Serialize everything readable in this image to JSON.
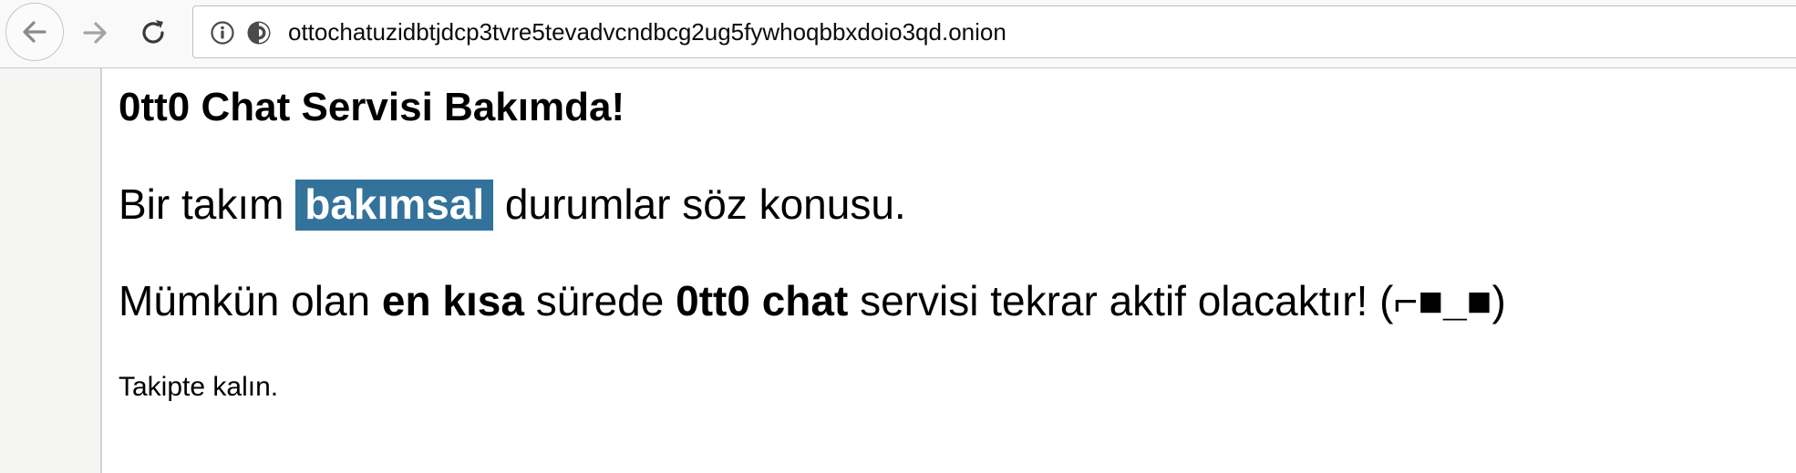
{
  "browser": {
    "url": "ottochatuzidbtjdcp3tvre5tevadvcndbcg2ug5fywhoqbbxdoio3qd.onion",
    "icons": {
      "back": "back-arrow-icon",
      "forward": "forward-arrow-icon",
      "reload": "reload-icon",
      "info": "info-icon",
      "onion": "onion-circuit-icon"
    }
  },
  "page": {
    "title": "0tt0 Chat Servisi Bakımda!",
    "para1": {
      "before": "Bir takım ",
      "highlight": "bakımsal",
      "after": " durumlar söz konusu."
    },
    "para2": {
      "part1": "Mümkün olan ",
      "bold1": "en kısa",
      "part2": " sürede ",
      "bold2": "0tt0 chat",
      "part3": " servisi tekrar aktif olacaktır! (",
      "bold3": "⌐■_■",
      "part4": ")"
    },
    "para3": "Takipte kalın."
  },
  "colors": {
    "highlight_bg": "#33729b",
    "highlight_text": "#ffffff",
    "toolbar_bg": "#f9f9fa"
  }
}
